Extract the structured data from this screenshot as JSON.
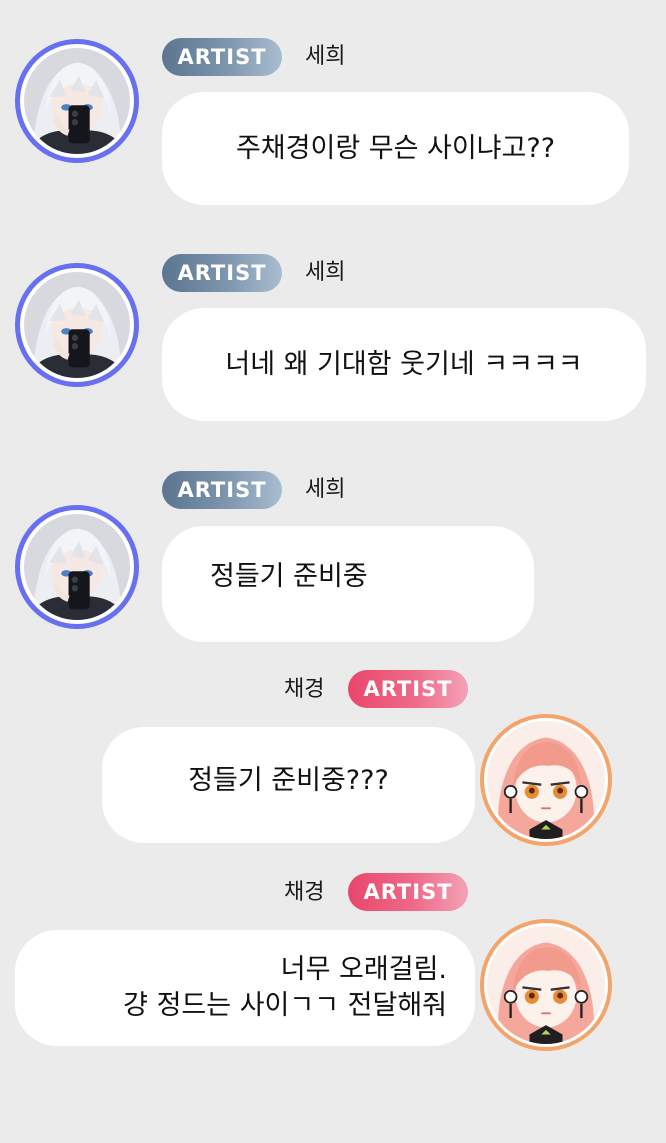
{
  "messages": [
    {
      "sender": "세희",
      "badge": "ARTIST",
      "side": "left",
      "text": "주채경이랑 무슨 사이냐고??"
    },
    {
      "sender": "세희",
      "badge": "ARTIST",
      "side": "left",
      "text": "너네 왜 기대함 웃기네 ㅋㅋㅋㅋ"
    },
    {
      "sender": "세희",
      "badge": "ARTIST",
      "side": "left",
      "text": "정들기 준비중"
    },
    {
      "sender": "채경",
      "badge": "ARTIST",
      "side": "right",
      "text": "정들기 준비중???"
    },
    {
      "sender": "채경",
      "badge": "ARTIST",
      "side": "right",
      "text_line1": "너무 오래걸림.",
      "text_line2": "걍 정드는 사이ㄱㄱ 전달해줘"
    }
  ],
  "colors": {
    "background": "#ebebeb",
    "bubble": "#ffffff",
    "badge_sehee": "#6f88a3",
    "badge_chaegyeong": "#ec5a7d",
    "avatar_ring_sehee": "#6670f0",
    "avatar_ring_chaegyeong": "#f3a46b"
  },
  "icons": {
    "sehee_avatar": "silver-haired-character-avatar",
    "chaegyeong_avatar": "pink-haired-character-avatar"
  }
}
